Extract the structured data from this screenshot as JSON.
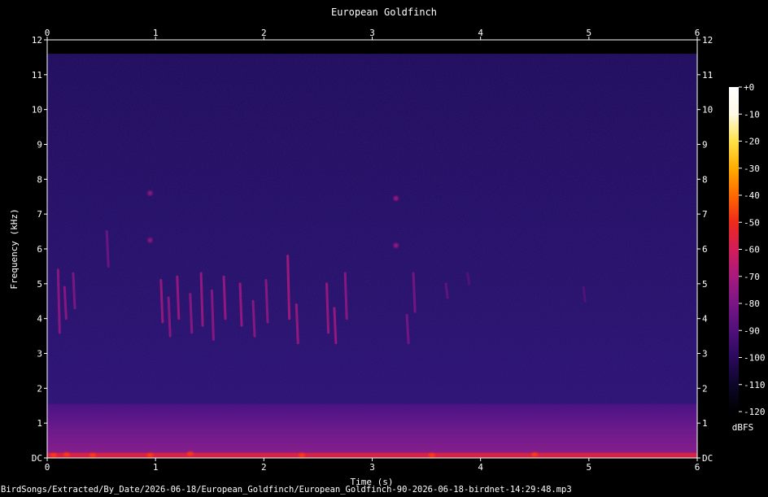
{
  "chart_data": {
    "type": "heatmap",
    "title": "European Goldfinch",
    "xlabel": "Time (s)",
    "ylabel": "Frequency (kHz)",
    "xlim": [
      0,
      6
    ],
    "ylim": [
      0,
      12
    ],
    "x_ticks": [
      "0",
      "1",
      "2",
      "3",
      "4",
      "5",
      "6"
    ],
    "y_ticks": [
      "DC",
      "1",
      "2",
      "3",
      "4",
      "5",
      "6",
      "7",
      "8",
      "9",
      "10",
      "11",
      "12"
    ],
    "colorbar": {
      "label": "dBFS",
      "range": [
        -120,
        0
      ],
      "ticks": [
        "+0",
        "-10",
        "-20",
        "-30",
        "-40",
        "-50",
        "-60",
        "-70",
        "-80",
        "-90",
        "-100",
        "-110",
        "-120"
      ],
      "colors": [
        "#000000",
        "#0d0629",
        "#2a0a5c",
        "#50107a",
        "#7a1685",
        "#a81a7e",
        "#d21d5a",
        "#ee2a1c",
        "#ff6a00",
        "#ffad00",
        "#ffe24a",
        "#fffae6",
        "#ffffff"
      ]
    },
    "background_level_dbfs": -105,
    "low_band": {
      "freq_khz": [
        0,
        1.55
      ],
      "level_dbfs": -80
    },
    "dc_band": {
      "freq_khz": [
        0,
        0.15
      ],
      "level_dbfs": -55
    },
    "bright_spots": [
      {
        "t": 0.06,
        "f": 0.08
      },
      {
        "t": 0.18,
        "f": 0.1
      },
      {
        "t": 0.42,
        "f": 0.08
      },
      {
        "t": 0.95,
        "f": 0.08
      },
      {
        "t": 1.32,
        "f": 0.12
      },
      {
        "t": 2.35,
        "f": 0.08
      },
      {
        "t": 3.55,
        "f": 0.08
      },
      {
        "t": 4.5,
        "f": 0.1
      }
    ],
    "calls": [
      {
        "t": 0.1,
        "f_start": 5.4,
        "f_end": 3.6,
        "level_dbfs": -75
      },
      {
        "t": 0.16,
        "f_start": 4.9,
        "f_end": 4.0,
        "level_dbfs": -75
      },
      {
        "t": 0.24,
        "f_start": 5.3,
        "f_end": 4.3,
        "level_dbfs": -78
      },
      {
        "t": 0.55,
        "f_start": 6.5,
        "f_end": 5.5,
        "level_dbfs": -82
      },
      {
        "t": 1.05,
        "f_start": 5.1,
        "f_end": 3.9,
        "level_dbfs": -72
      },
      {
        "t": 1.12,
        "f_start": 4.6,
        "f_end": 3.5,
        "level_dbfs": -75
      },
      {
        "t": 1.2,
        "f_start": 5.2,
        "f_end": 4.0,
        "level_dbfs": -72
      },
      {
        "t": 1.32,
        "f_start": 4.7,
        "f_end": 3.6,
        "level_dbfs": -75
      },
      {
        "t": 1.42,
        "f_start": 5.3,
        "f_end": 3.8,
        "level_dbfs": -72
      },
      {
        "t": 1.52,
        "f_start": 4.8,
        "f_end": 3.4,
        "level_dbfs": -75
      },
      {
        "t": 1.63,
        "f_start": 5.2,
        "f_end": 4.0,
        "level_dbfs": -72
      },
      {
        "t": 1.78,
        "f_start": 5.0,
        "f_end": 3.8,
        "level_dbfs": -72
      },
      {
        "t": 1.9,
        "f_start": 4.5,
        "f_end": 3.5,
        "level_dbfs": -75
      },
      {
        "t": 2.02,
        "f_start": 5.1,
        "f_end": 3.9,
        "level_dbfs": -75
      },
      {
        "t": 2.22,
        "f_start": 5.8,
        "f_end": 4.0,
        "level_dbfs": -70
      },
      {
        "t": 2.3,
        "f_start": 4.4,
        "f_end": 3.3,
        "level_dbfs": -72
      },
      {
        "t": 2.58,
        "f_start": 5.0,
        "f_end": 3.6,
        "level_dbfs": -72
      },
      {
        "t": 2.65,
        "f_start": 4.3,
        "f_end": 3.3,
        "level_dbfs": -72
      },
      {
        "t": 2.75,
        "f_start": 5.3,
        "f_end": 4.0,
        "level_dbfs": -75
      },
      {
        "t": 3.32,
        "f_start": 4.1,
        "f_end": 3.3,
        "level_dbfs": -80
      },
      {
        "t": 3.38,
        "f_start": 5.3,
        "f_end": 4.2,
        "level_dbfs": -80
      },
      {
        "t": 3.68,
        "f_start": 5.0,
        "f_end": 4.6,
        "level_dbfs": -85
      },
      {
        "t": 3.88,
        "f_start": 5.3,
        "f_end": 5.0,
        "level_dbfs": -88
      },
      {
        "t": 4.95,
        "f_start": 4.9,
        "f_end": 4.5,
        "level_dbfs": -88
      }
    ],
    "dots": [
      {
        "t": 0.95,
        "f": 7.6,
        "level_dbfs": -75
      },
      {
        "t": 0.95,
        "f": 6.25,
        "level_dbfs": -75
      },
      {
        "t": 3.22,
        "f": 7.45,
        "level_dbfs": -72
      },
      {
        "t": 3.22,
        "f": 6.1,
        "level_dbfs": -72
      }
    ]
  },
  "footer": {
    "file_path": "BirdSongs/Extracted/By_Date/2026-06-18/European_Goldfinch/European_Goldfinch-90-2026-06-18-birdnet-14:29:48.mp3"
  }
}
